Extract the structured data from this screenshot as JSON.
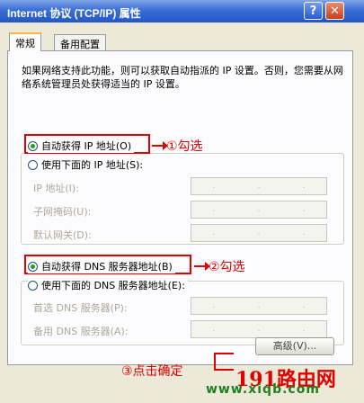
{
  "window": {
    "title": "Internet 协议 (TCP/IP) 属性",
    "help": "?",
    "close": "✕"
  },
  "tabs": [
    "常规",
    "备用配置"
  ],
  "description": "如果网络支持此功能，则可以获取自动指派的 IP 设置。否则，您需要从网络系统管理员处获得适当的 IP 设置。",
  "ip_section": {
    "auto_label": "自动获得 IP 地址(O)",
    "manual_label": "使用下面的 IP 地址(S):",
    "fields": [
      {
        "label": "IP 地址(I):"
      },
      {
        "label": "子网掩码(U):"
      },
      {
        "label": "默认网关(D):"
      }
    ],
    "annotation": "①勾选"
  },
  "dns_section": {
    "auto_label": "自动获得 DNS 服务器地址(B)",
    "manual_label": "使用下面的 DNS 服务器地址(E):",
    "fields": [
      {
        "label": "首选 DNS 服务器(P):"
      },
      {
        "label": "备用 DNS 服务器(A):"
      }
    ],
    "annotation": "②勾选"
  },
  "advanced_button": "高级(V)...",
  "bottom_annotation": "③点击确定",
  "watermark": {
    "line1": "191路由网",
    "line2": "www.xiqb.com"
  },
  "colors": {
    "annotation": "#e00000",
    "titlebar": "#2456c4",
    "dialog_bg": "#ece9d8"
  }
}
